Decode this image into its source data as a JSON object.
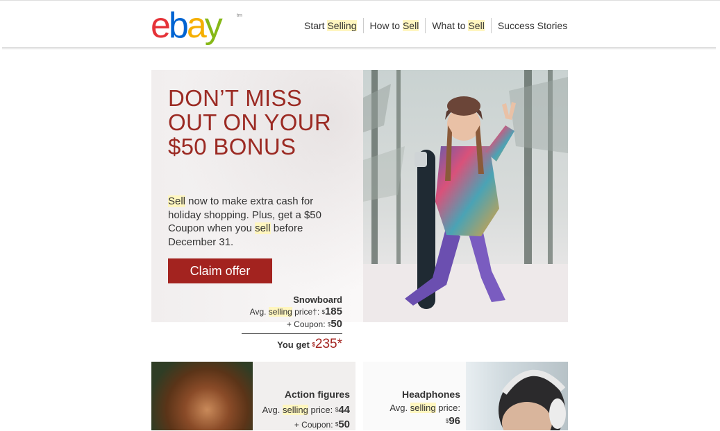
{
  "header": {
    "logo": {
      "letters": [
        "e",
        "b",
        "a",
        "y"
      ],
      "tm": "tm",
      "colors": [
        "#e53238",
        "#0064d2",
        "#f5af02",
        "#86b817"
      ]
    },
    "nav": [
      {
        "prefix": "Start ",
        "highlight": "Selling"
      },
      {
        "prefix": "How to ",
        "highlight": "Sell"
      },
      {
        "prefix": "What to ",
        "highlight": "Sell"
      },
      {
        "prefix": "Success Stories",
        "highlight": ""
      }
    ]
  },
  "hero": {
    "headline": "DON’T MISS OUT ON YOUR $50 BONUS",
    "body": {
      "hl1": "Sell",
      "part1": " now to make extra cash for holiday shopping. Plus, get a $50 Coupon when you ",
      "hl2": "sell",
      "part2": " before December 31."
    },
    "cta_label": "Claim offer",
    "accent_color": "#a3231f",
    "price": {
      "title": "Snowboard",
      "avg_prefix": "Avg. ",
      "avg_hl": "selling",
      "avg_suffix": " price†: ",
      "dollar": "$",
      "avg_value": "185",
      "coupon_label": "+ Coupon: ",
      "coupon_value": "50",
      "you_get_label": "You get ",
      "you_get_value": "235",
      "asterisk": "*"
    }
  },
  "cards": [
    {
      "title": "Action figures",
      "avg_prefix": "Avg. ",
      "avg_hl": "selling",
      "avg_suffix": " price: ",
      "dollar": "$",
      "avg_value": "44",
      "coupon_label": "+ Coupon: ",
      "coupon_value": "50"
    },
    {
      "title": "Headphones",
      "avg_prefix": "Avg. ",
      "avg_hl": "selling",
      "avg_suffix": " price:",
      "dollar": "$",
      "avg_value": "96"
    }
  ]
}
